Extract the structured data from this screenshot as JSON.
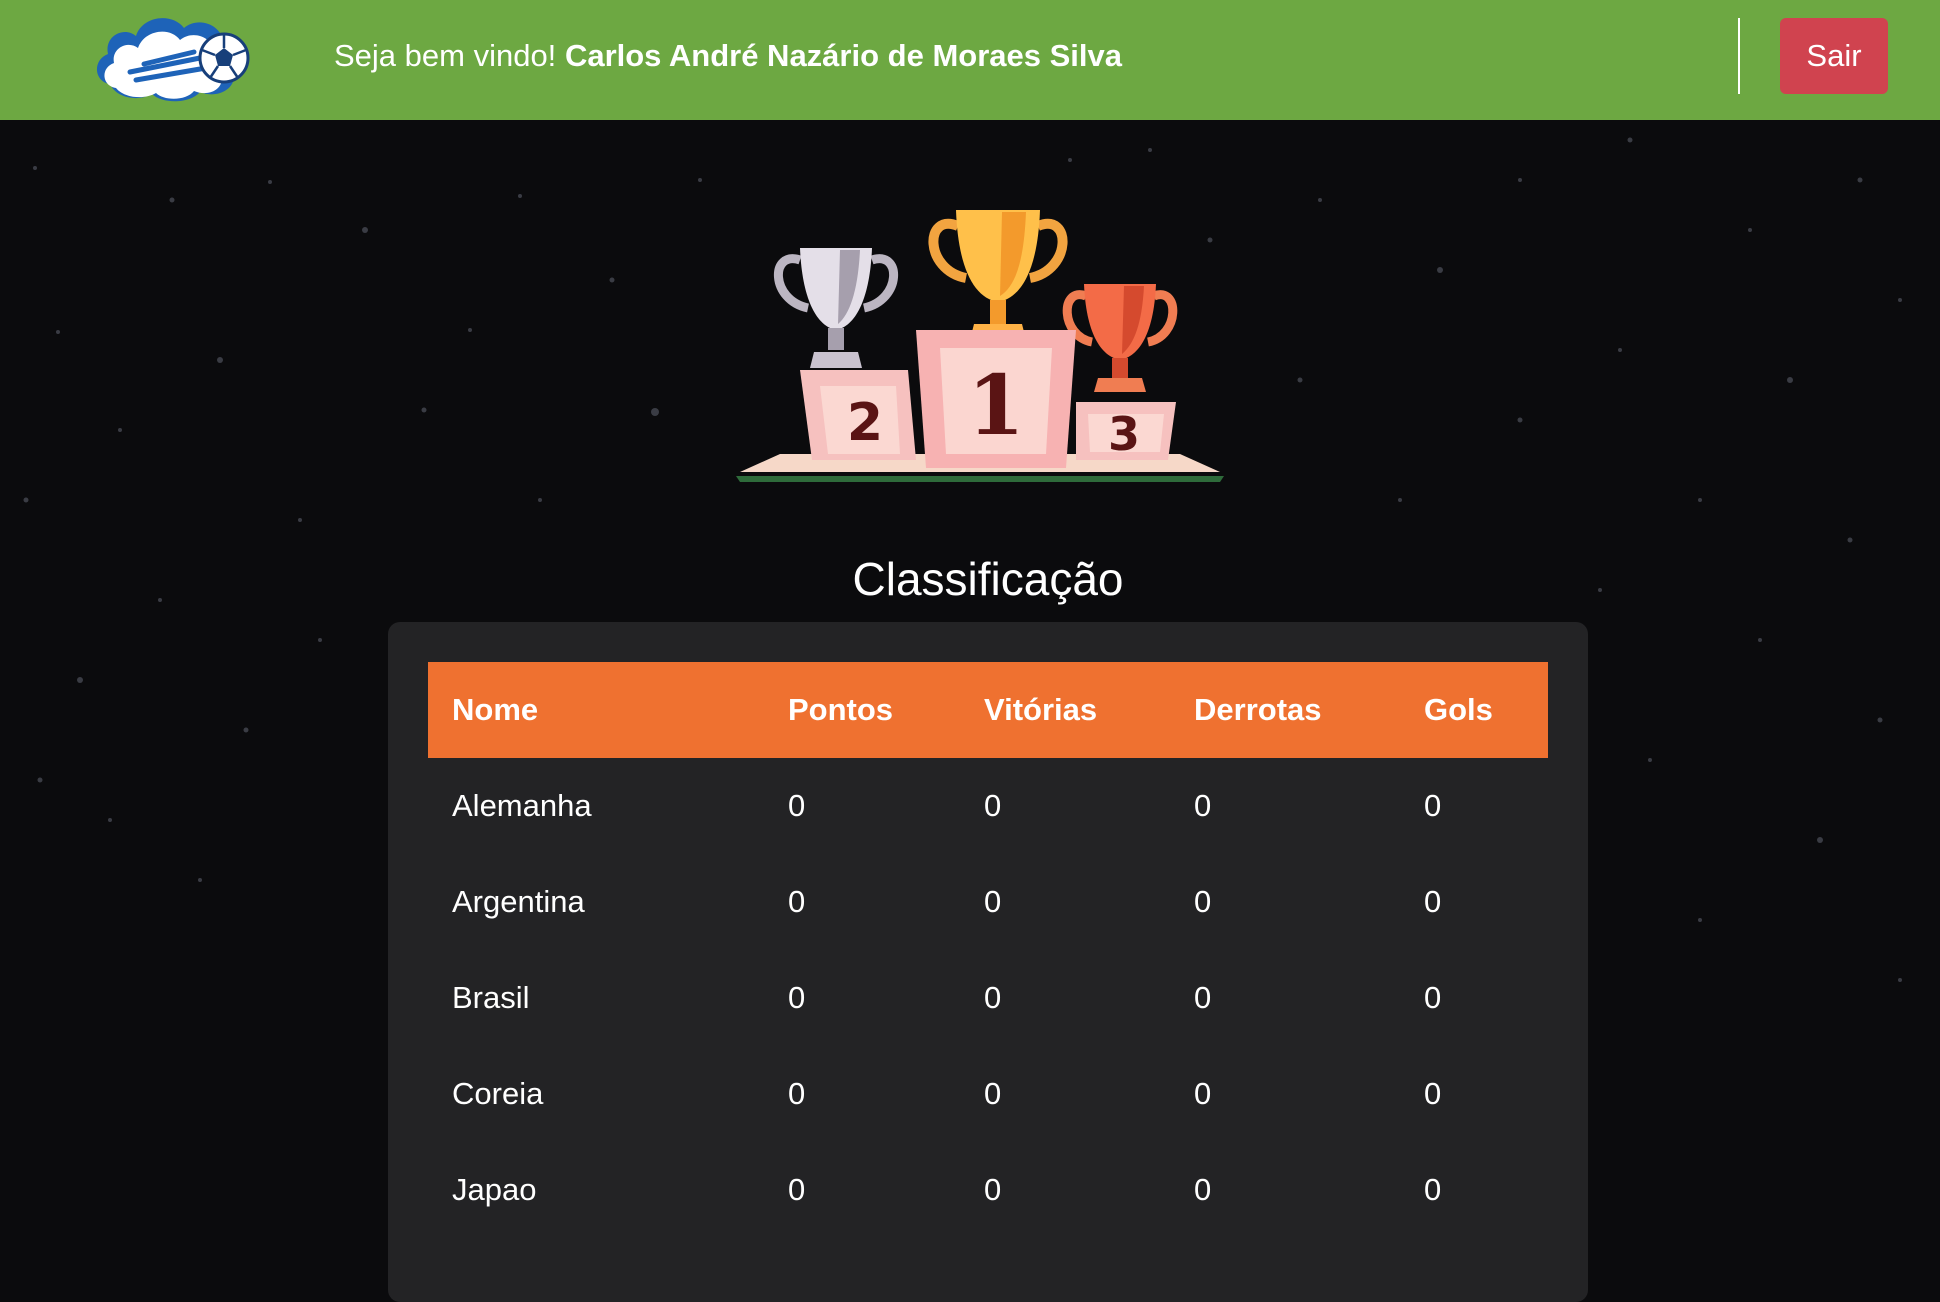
{
  "header": {
    "welcome_prefix": "Seja bem vindo!",
    "user_name": "Carlos André Nazário de Moraes Silva",
    "logout_label": "Sair",
    "bg_color": "#6da842",
    "logout_color": "#d0434f"
  },
  "podium": {
    "places": [
      "2",
      "1",
      "3"
    ]
  },
  "main": {
    "title": "Classificação"
  },
  "table": {
    "header_color": "#ef7130",
    "columns": [
      "Nome",
      "Pontos",
      "Vitórias",
      "Derrotas",
      "Gols"
    ],
    "rows": [
      [
        "Alemanha",
        "0",
        "0",
        "0",
        "0"
      ],
      [
        "Argentina",
        "0",
        "0",
        "0",
        "0"
      ],
      [
        "Brasil",
        "0",
        "0",
        "0",
        "0"
      ],
      [
        "Coreia",
        "0",
        "0",
        "0",
        "0"
      ],
      [
        "Japao",
        "0",
        "0",
        "0",
        "0"
      ]
    ]
  }
}
